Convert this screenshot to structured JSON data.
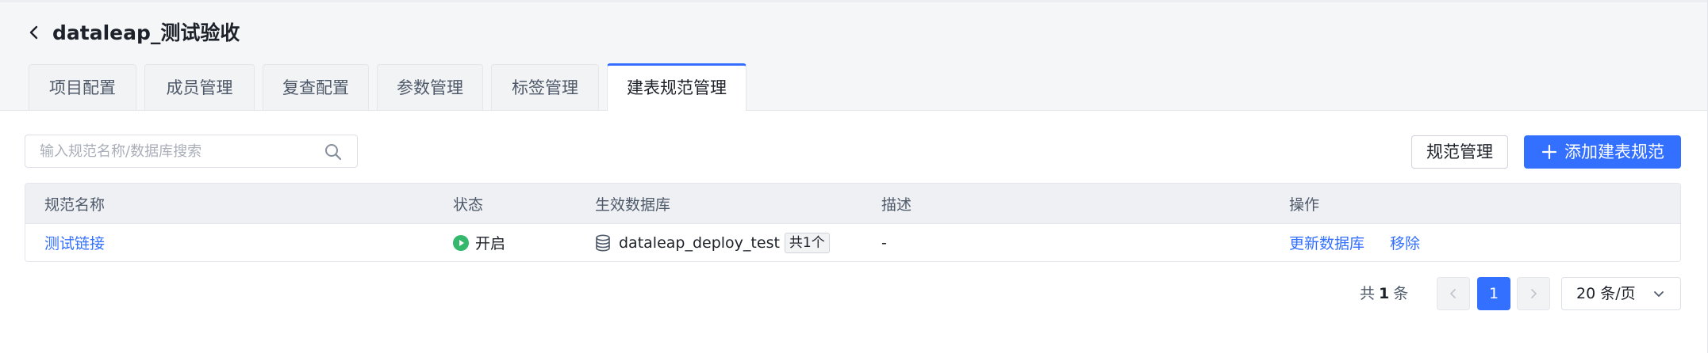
{
  "header": {
    "title": "dataleap_测试验收",
    "back_icon": "chevron-left-icon"
  },
  "tabs": [
    {
      "label": "项目配置",
      "active": false
    },
    {
      "label": "成员管理",
      "active": false
    },
    {
      "label": "复查配置",
      "active": false
    },
    {
      "label": "参数管理",
      "active": false
    },
    {
      "label": "标签管理",
      "active": false
    },
    {
      "label": "建表规范管理",
      "active": true
    }
  ],
  "search": {
    "placeholder": "输入规范名称/数据库搜索",
    "value": "",
    "icon": "search-icon"
  },
  "toolbar": {
    "spec_manage_label": "规范管理",
    "add_label": "添加建表规范",
    "add_icon": "plus-icon"
  },
  "table": {
    "columns": [
      "规范名称",
      "状态",
      "生效数据库",
      "描述",
      "操作"
    ],
    "rows": [
      {
        "name": "测试链接",
        "status": "开启",
        "status_icon": "play-circle-icon",
        "database": "dataleap_deploy_test",
        "database_icon": "database-icon",
        "db_count": "共1个",
        "description": "-",
        "actions": [
          "更新数据库",
          "移除"
        ]
      }
    ]
  },
  "pagination": {
    "total_prefix": "共",
    "total": "1",
    "total_suffix": "条",
    "current_page": "1",
    "page_size": "20 条/页"
  },
  "colors": {
    "primary": "#3370ff",
    "status_on": "#35b86b",
    "header_bg": "#f5f6f8",
    "table_head_bg": "#eef0f4"
  }
}
